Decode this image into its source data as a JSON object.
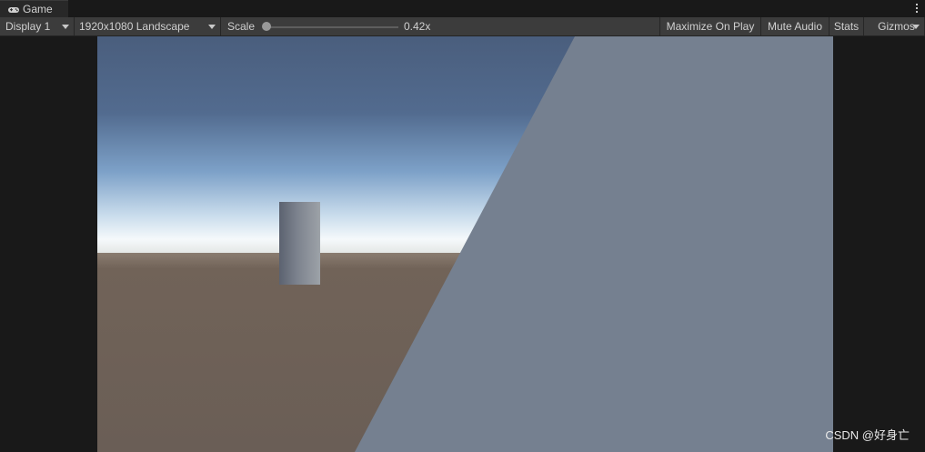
{
  "tab": {
    "title": "Game",
    "icon": "gamepad-icon"
  },
  "toolbar": {
    "display": "Display 1",
    "resolution": "1920x1080 Landscape",
    "scale_label": "Scale",
    "scale_value": "0.42x",
    "maximize": "Maximize On Play",
    "mute": "Mute Audio",
    "stats": "Stats",
    "gizmos": "Gizmos"
  },
  "watermark": "CSDN @好身亡",
  "colors": {
    "panel": "#191919",
    "toolbar": "#3c3c3c",
    "sky_top": "#4a5f80",
    "horizon": "#f4f8fb",
    "ground": "#6a5e57",
    "plane": "#758090"
  }
}
